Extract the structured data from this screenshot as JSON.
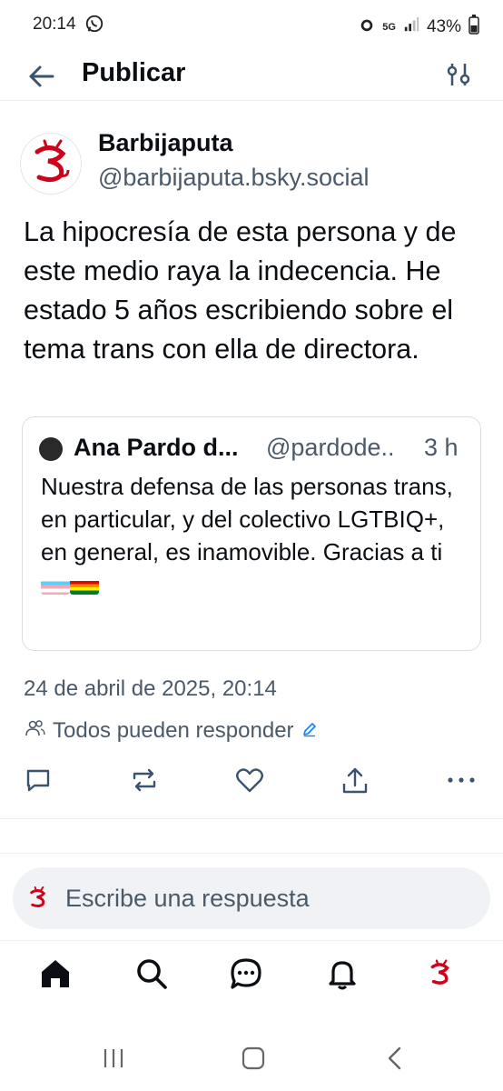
{
  "status": {
    "time": "20:14",
    "network": "5G",
    "battery": "43%"
  },
  "header": {
    "title": "Publicar",
    "back_icon": "arrow-left-icon",
    "settings_icon": "sliders-icon"
  },
  "post": {
    "author_name": "Barbijaputa",
    "author_handle": "@barbijaputa.bsky.social",
    "text": "La hipocresía de esta persona y de este medio raya la indecencia. He estado 5 años escribiendo sobre el tema trans con ella de directora.",
    "date": "24 de abril de 2025, 20:14",
    "reply_setting": "Todos pueden responder"
  },
  "quote": {
    "author_name": "Ana Pardo d...",
    "author_handle": "@pardode..",
    "time": "3 h",
    "text": "Nuestra defensa de las personas trans, en particular, y del colectivo LGTBIQ+, en general, es inamovible. Gracias a ti"
  },
  "reply": {
    "placeholder": "Escribe una respuesta"
  },
  "colors": {
    "accent": "#1083fe",
    "brand_red": "#d0021b",
    "muted": "#4a5a6a"
  }
}
